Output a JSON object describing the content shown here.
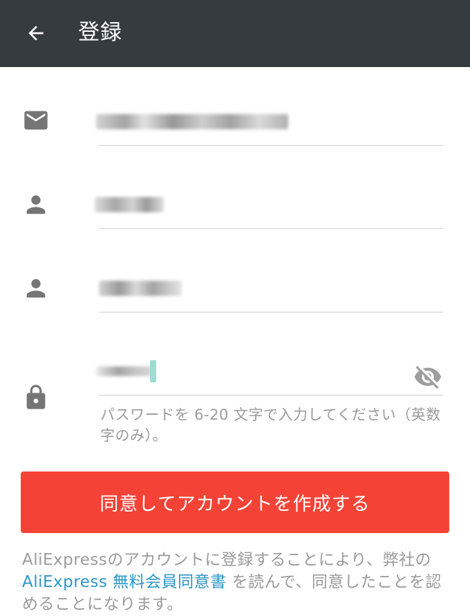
{
  "appbar": {
    "title": "登録",
    "back_icon": "arrow-left-icon"
  },
  "fields": {
    "email": {
      "icon": "email-icon",
      "value_redacted": true
    },
    "first_name": {
      "icon": "person-icon",
      "value_redacted": true
    },
    "last_name": {
      "icon": "person-icon",
      "value_redacted": true
    },
    "password": {
      "icon": "lock-icon",
      "toggle_icon": "eye-off-icon",
      "value_redacted": true
    }
  },
  "password_hint": "パスワードを 6-20 文字で入力してください（英数字のみ）。",
  "primary_button": {
    "label": "同意してアカウントを作成する"
  },
  "terms": {
    "prefix": "AliExpressのアカウントに登録することにより、弊社の",
    "link": "AliExpress 無料会員同意書",
    "suffix": "を読んで、同意したことを認めることになります。"
  },
  "colors": {
    "appbar": "#363b40",
    "primary": "#f44336",
    "link": "#2a96c7",
    "icon": "#757575",
    "hint": "#9b9b9b"
  }
}
